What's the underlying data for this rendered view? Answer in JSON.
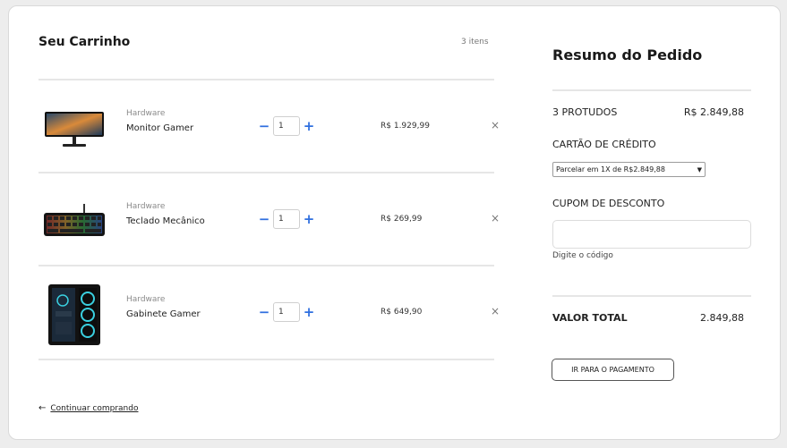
{
  "cart": {
    "title": "Seu Carrinho",
    "count": "3 itens",
    "items": [
      {
        "category": "Hardware",
        "name": "Monitor Gamer",
        "quantity": "1",
        "price": "R$ 1.929,99",
        "image_icon": "monitor-icon"
      },
      {
        "category": "Hardware",
        "name": "Teclado Mecânico",
        "quantity": "1",
        "price": "R$ 269,99",
        "image_icon": "keyboard-icon"
      },
      {
        "category": "Hardware",
        "name": "Gabinete Gamer",
        "quantity": "1",
        "price": "R$ 649,90",
        "image_icon": "pc-case-icon"
      }
    ],
    "qty_minus": "−",
    "qty_plus": "+",
    "remove_symbol": "×",
    "continue_label": "Continuar comprando"
  },
  "summary": {
    "title": "Resumo do Pedido",
    "products_label": "3 PROTUDOS",
    "products_value": "R$ 2.849,88",
    "card_label": "CARTÃO DE CRÉDITO",
    "installments_selected": "Parcelar em 1X de R$2.849,88",
    "coupon_label": "CUPOM DE DESCONTO",
    "coupon_hint": "Digite o código",
    "total_label": "VALOR TOTAL",
    "total_value": "2.849,88",
    "pay_button": "IR PARA O PAGAMENTO"
  },
  "colors": {
    "accent": "#2f6fdf",
    "background": "#ededed",
    "card": "#ffffff"
  }
}
